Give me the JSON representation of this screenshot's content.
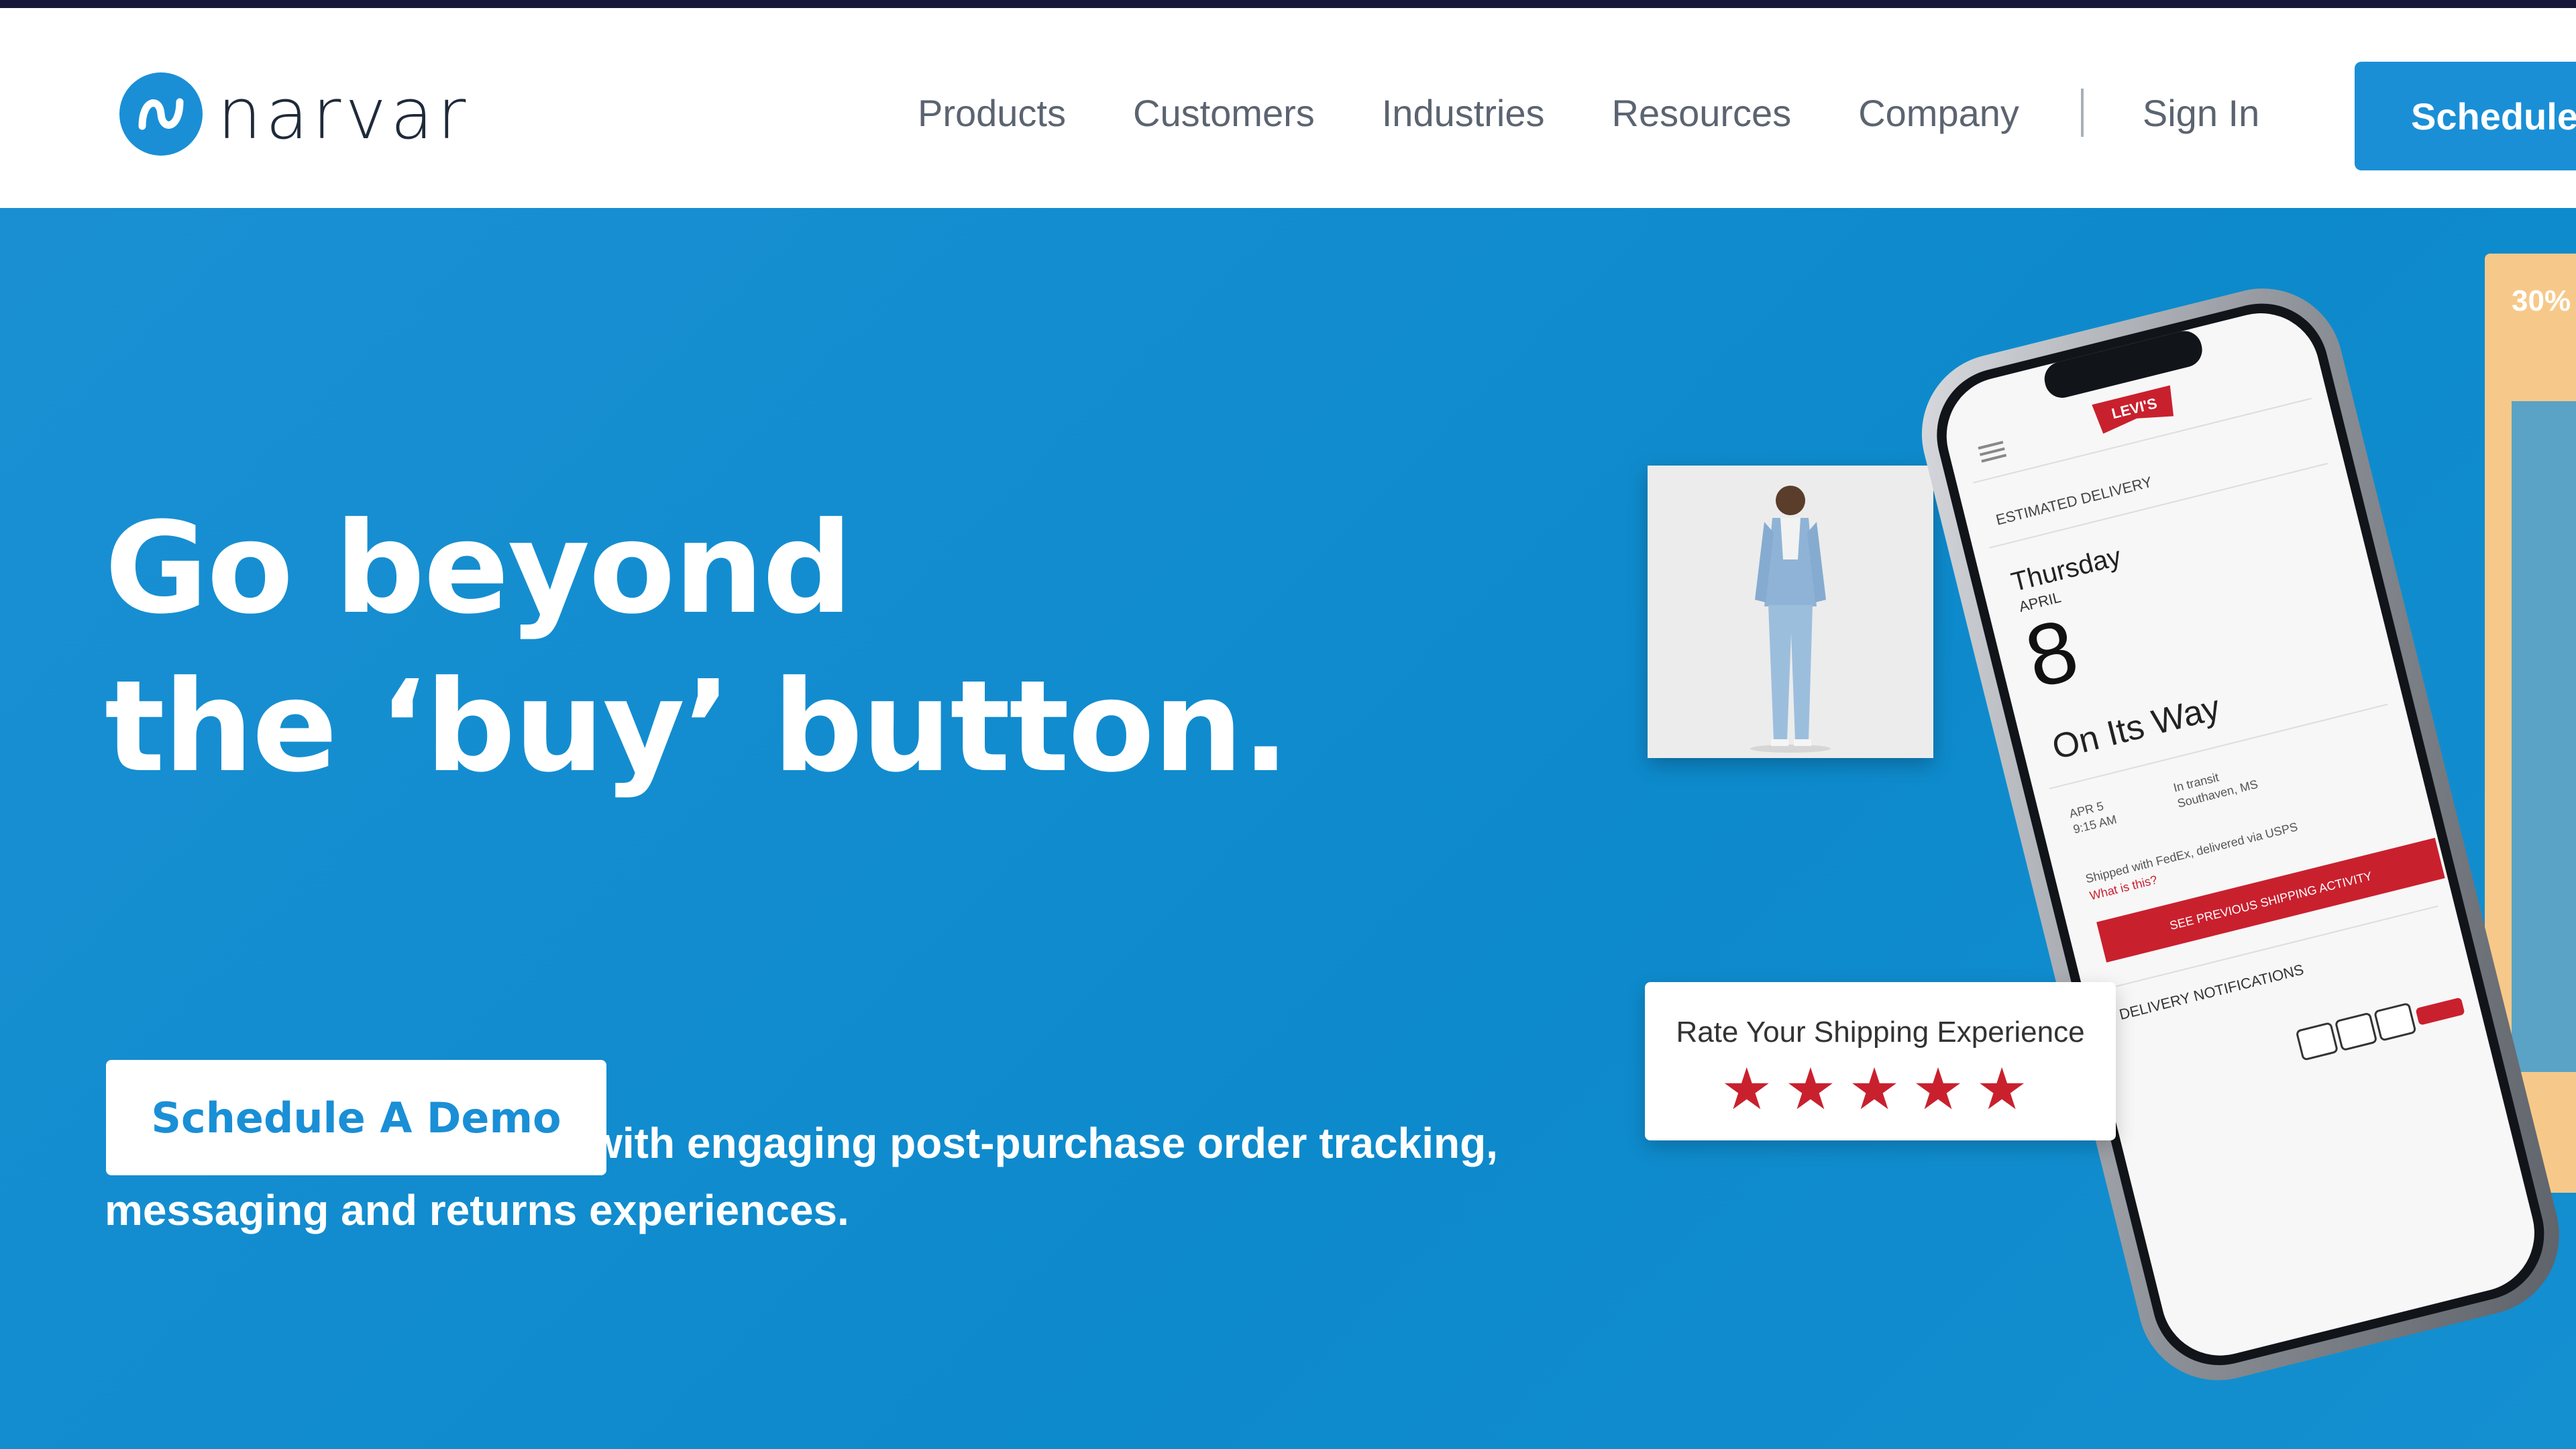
{
  "brand": {
    "name": "narvar",
    "accent": "#1a8fd6",
    "dark": "#16163a"
  },
  "nav": {
    "items": [
      "Products",
      "Customers",
      "Industries",
      "Resources",
      "Company"
    ],
    "signin": "Sign In",
    "cta": "Schedule"
  },
  "hero": {
    "headline_line1": "Go beyond",
    "headline_line2": "the ‘buy’ button.",
    "subtext": "Create loyal customers with engaging post-purchase order tracking, messaging and returns experiences.",
    "cta": "Schedule A Demo",
    "background": "#1a90d3"
  },
  "rating_card": {
    "label": "Rate Your Shipping Experience",
    "stars": "★★★★★"
  },
  "phone": {
    "brand": "LEVI'S",
    "estimated_label": "ESTIMATED DELIVERY",
    "weekday": "Thursday",
    "month": "APRIL",
    "day": "8",
    "status": "On Its Way",
    "event_date": "APR 5",
    "event_time": "9:15 AM",
    "event_status": "In transit",
    "event_location": "Southaven, MS",
    "shipped_with": "Shipped with FedEx, delivered via USPS",
    "what_is_this": "What is this?",
    "activity_button": "SEE PREVIOUS SHIPPING ACTIVITY",
    "notifications_label": "DELIVERY NOTIFICATIONS"
  },
  "peek_card": {
    "text": "30%"
  }
}
